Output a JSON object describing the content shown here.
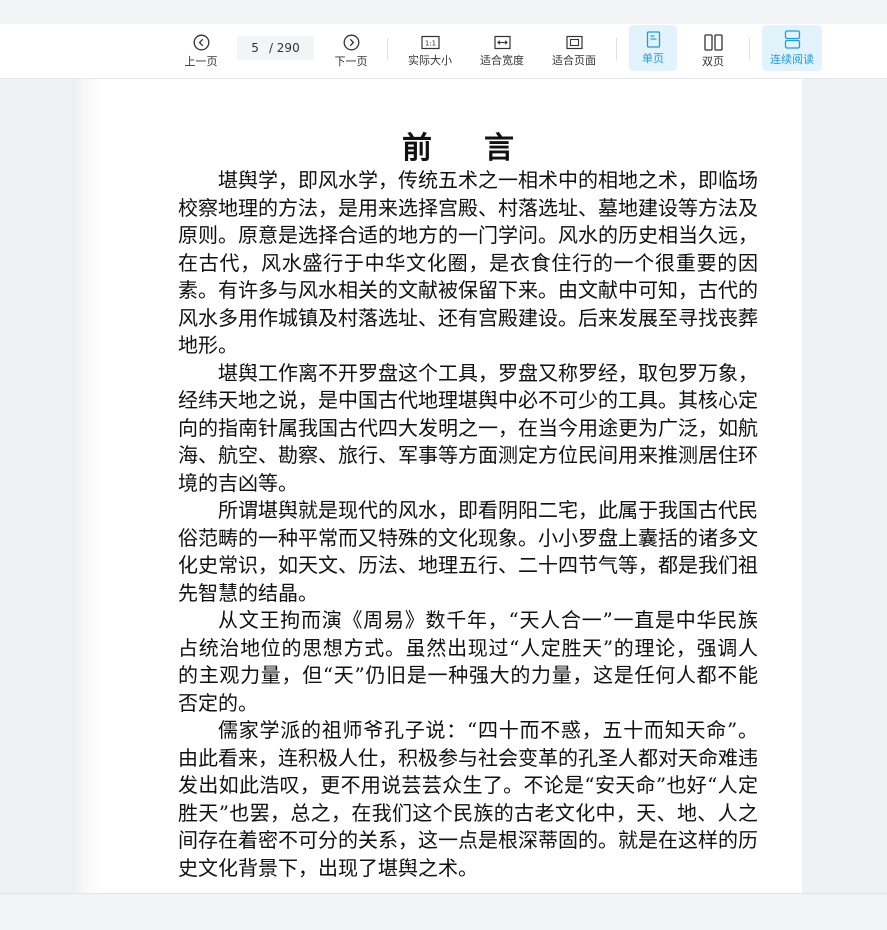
{
  "toolbar": {
    "prev_page_label": "上一页",
    "current_page": "5",
    "total_pages": "/ 290",
    "next_page_label": "下一页",
    "actual_size_label": "实际大小",
    "fit_width_label": "适合宽度",
    "fit_page_label": "适合页面",
    "single_page_label": "单页",
    "double_page_label": "双页",
    "continuous_label": "连续阅读",
    "accent_color": "#1a9ee0",
    "active_bg": "#e3f3fc"
  },
  "document": {
    "title": "前言",
    "paragraphs": [
      "堪舆学，即风水学，传统五术之一相术中的相地之术，即临场校察地理的方法，是用来选择宫殿、村落选址、墓地建设等方法及原则。原意是选择合适的地方的一门学问。风水的历史相当久远，在古代，风水盛行于中华文化圈，是衣食住行的一个很重要的因素。有许多与风水相关的文献被保留下来。由文献中可知，古代的风水多用作城镇及村落选址、还有宫殿建设。后来发展至寻找丧葬地形。",
      "堪舆工作离不开罗盘这个工具，罗盘又称罗经，取包罗万象，经纬天地之说，是中国古代地理堪舆中必不可少的工具。其核心定向的指南针属我国古代四大发明之一，在当今用途更为广泛，如航海、航空、勘察、旅行、军事等方面测定方位民间用来推测居住环境的吉凶等。",
      "所谓堪舆就是现代的风水，即看阴阳二宅，此属于我国古代民俗范畴的一种平常而又特殊的文化现象。小小罗盘上囊括的诸多文化史常识，如天文、历法、地理五行、二十四节气等，都是我们祖先智慧的结晶。",
      "从文王拘而演《周易》数千年，“天人合一”一直是中华民族占统治地位的思想方式。虽然出现过“人定胜天”的理论，强调人的主观力量，但“天”仍旧是一种强大的力量，这是任何人都不能否定的。",
      "儒家学派的祖师爷孔子说：“四十而不惑，五十而知天命”。由此看来，连积极人仕，积极参与社会变革的孔圣人都对天命难违发出如此浩叹，更不用说芸芸众生了。不论是“安天命”也好“人定胜天”也罢，总之，在我们这个民族的古老文化中，天、地、人之间存在着密不可分的关系，这一点是根深蒂固的。就是在这样的历史文化背景下，出现了堪舆之术。"
    ]
  }
}
